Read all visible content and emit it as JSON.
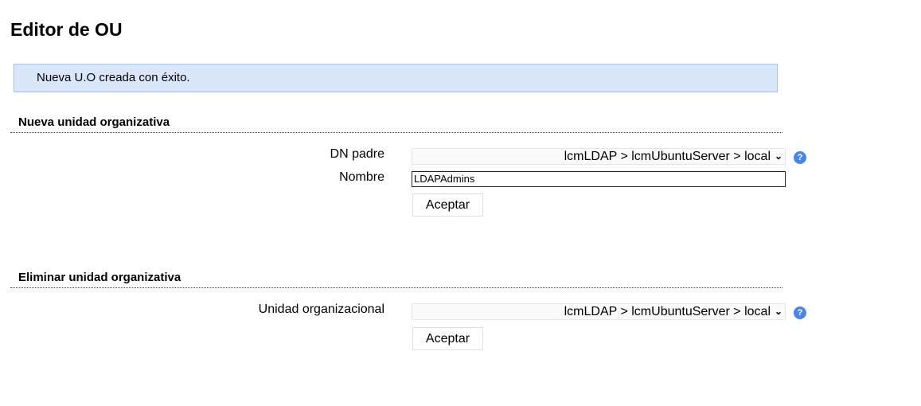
{
  "page": {
    "title": "Editor de OU"
  },
  "message": {
    "text": "Nueva U.O creada con éxito."
  },
  "new_ou": {
    "title": "Nueva unidad organizativa",
    "parent_dn_label": "DN padre",
    "parent_dn_value": "lcmLDAP > lcmUbuntuServer > local",
    "name_label": "Nombre",
    "name_value": "LDAPAdmins",
    "submit_label": "Aceptar",
    "help_icon": "?"
  },
  "delete_ou": {
    "title": "Eliminar unidad organizativa",
    "ou_label": "Unidad organizacional",
    "ou_value": "lcmLDAP > lcmUbuntuServer > local",
    "submit_label": "Aceptar",
    "help_icon": "?"
  },
  "icons": {
    "help": "help-icon",
    "dropdown": "chevron-down-icon"
  },
  "colors": {
    "message_bg": "#dae6fc",
    "message_border": "#a6c0e6",
    "help_icon": "#4a86e8"
  }
}
